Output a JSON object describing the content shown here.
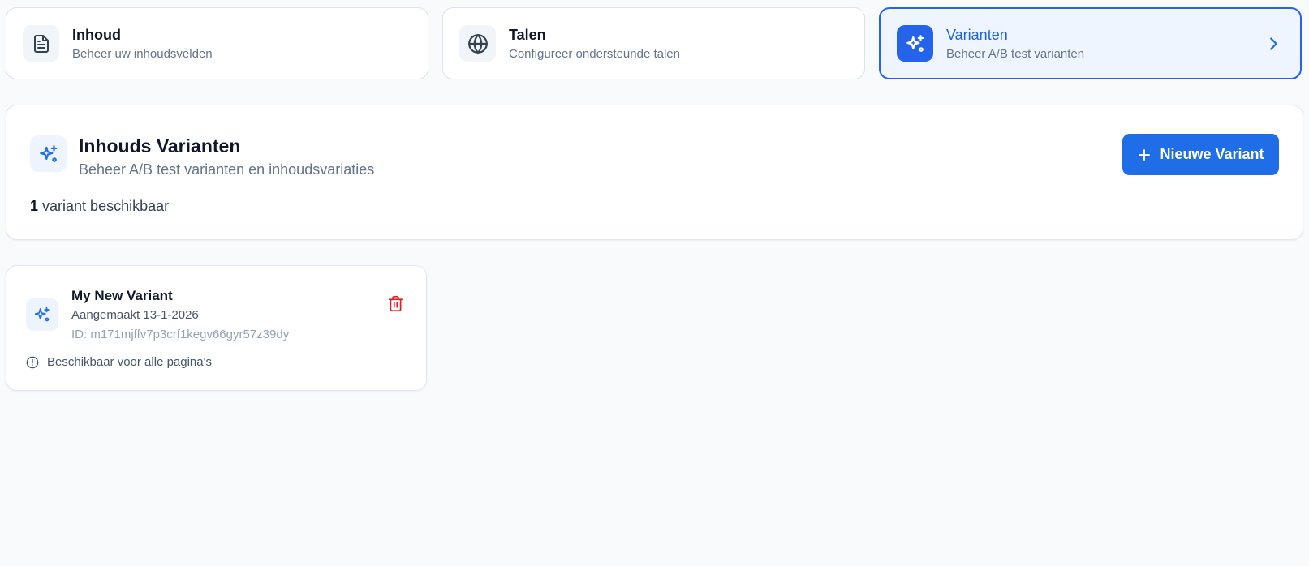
{
  "nav": {
    "cards": [
      {
        "title": "Inhoud",
        "subtitle": "Beheer uw inhoudsvelden",
        "icon": "document-icon",
        "active": false
      },
      {
        "title": "Talen",
        "subtitle": "Configureer ondersteunde talen",
        "icon": "globe-icon",
        "active": false
      },
      {
        "title": "Varianten",
        "subtitle": "Beheer A/B test varianten",
        "icon": "sparkles-icon",
        "active": true
      }
    ]
  },
  "header": {
    "title": "Inhouds Varianten",
    "subtitle": "Beheer A/B test varianten en inhoudsvariaties",
    "count": "1",
    "count_label": "variant beschikbaar",
    "new_button_label": "Nieuwe Variant"
  },
  "variants": [
    {
      "name": "My New Variant",
      "created": "Aangemaakt 13-1-2026",
      "id": "ID: m171mjffv7p3crf1kegv66gyr57z39dy",
      "scope": "Beschikbaar voor alle pagina's"
    }
  ],
  "colors": {
    "accent": "#1f6ee8",
    "active_bg": "#eef5ff",
    "danger": "#dc2626",
    "background": "#f8fafc"
  }
}
